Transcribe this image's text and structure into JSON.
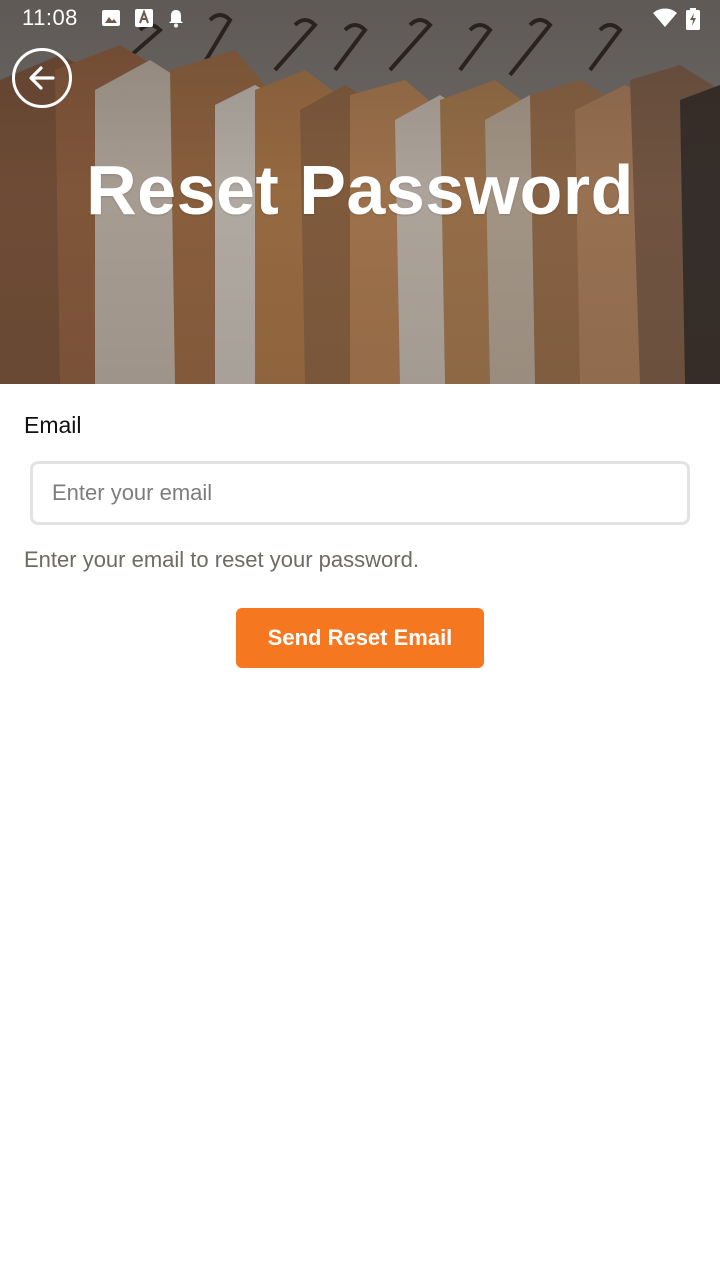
{
  "status_bar": {
    "time": "11:08",
    "left_icons": [
      "image-icon",
      "text-a-icon",
      "bell-icon"
    ],
    "right_icons": [
      "wifi-icon",
      "battery-charging-icon"
    ]
  },
  "header": {
    "back_icon": "arrow-left-icon",
    "title": "Reset Password",
    "background": "clothes-rack-photo"
  },
  "form": {
    "email_label": "Email",
    "email_placeholder": "Enter your email",
    "email_value": "",
    "helper_text": "Enter your email to reset your password.",
    "submit_label": "Send Reset Email"
  },
  "colors": {
    "accent": "#f57820",
    "title_text": "#ffffff",
    "helper_text": "#6e6a66",
    "input_border": "#e3e3e3"
  }
}
